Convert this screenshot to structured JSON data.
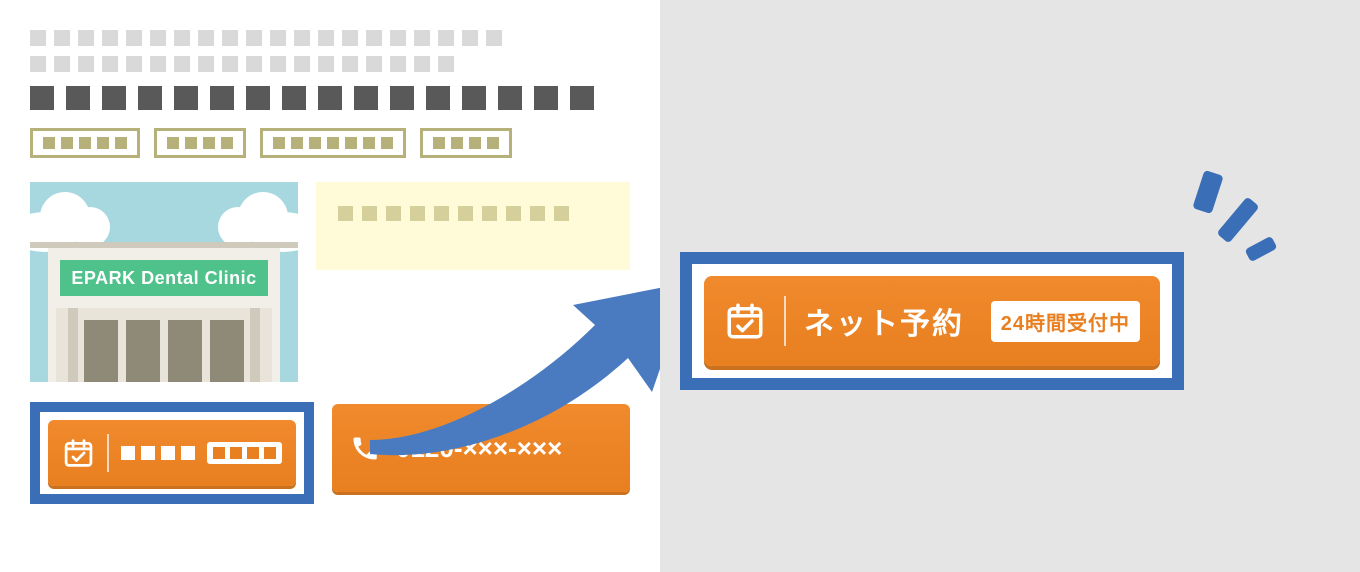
{
  "clinic": {
    "sign_label": "EPARK Dental Clinic"
  },
  "phone": {
    "number": "0120-×××-×××"
  },
  "reserve_button": {
    "label": "ネット予約",
    "badge": "24時間受付中"
  },
  "icons": {
    "calendar": "calendar-check-icon",
    "phone": "phone-icon"
  },
  "colors": {
    "accent_blue": "#3a6fb7",
    "accent_orange": "#e87f20",
    "sign_green": "#4fc28c"
  }
}
